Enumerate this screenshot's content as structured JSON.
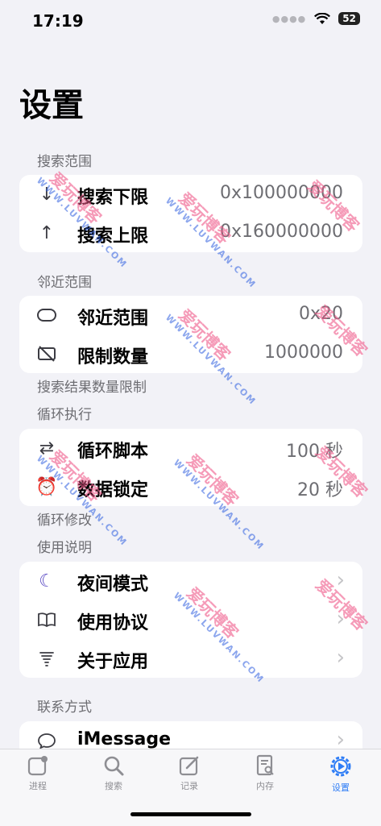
{
  "status_bar": {
    "time": "17:19",
    "battery": "52"
  },
  "title": "设置",
  "sections": {
    "search_range": {
      "header": "搜索范围",
      "rows": [
        {
          "label": "搜索下限",
          "value": "0x100000000",
          "icon": "arrow-down-icon"
        },
        {
          "label": "搜索上限",
          "value": "0x160000000",
          "icon": "arrow-up-icon"
        }
      ]
    },
    "nearby_range": {
      "header": "邻近范围",
      "footer": "搜索结果数量限制",
      "rows": [
        {
          "label": "邻近范围",
          "value": "0x20",
          "icon": "capsule-icon"
        },
        {
          "label": "限制数量",
          "value": "1000000",
          "icon": "rectangle-slash-icon"
        }
      ]
    },
    "loop": {
      "header": "循环执行",
      "footer": "循环修改",
      "rows": [
        {
          "label": "循环脚本",
          "value": "100 秒",
          "icon": "repeat-icon"
        },
        {
          "label": "数据锁定",
          "value": "20 秒",
          "icon": "alarm-icon"
        }
      ]
    },
    "instructions": {
      "header": "使用说明",
      "rows": [
        {
          "label": "夜间模式",
          "icon": "moon-icon"
        },
        {
          "label": "使用协议",
          "icon": "book-icon"
        },
        {
          "label": "关于应用",
          "icon": "tornado-icon"
        }
      ]
    },
    "contact": {
      "header": "联系方式",
      "rows": [
        {
          "label": "iMessage",
          "icon": "message-bubble-icon"
        }
      ]
    }
  },
  "tab_bar": {
    "tabs": [
      {
        "label": "进程",
        "icon": "process-icon",
        "active": false
      },
      {
        "label": "搜索",
        "icon": "search-icon",
        "active": false
      },
      {
        "label": "记录",
        "icon": "edit-icon",
        "active": false
      },
      {
        "label": "内存",
        "icon": "memory-doc-icon",
        "active": false
      },
      {
        "label": "设置",
        "icon": "gear-icon",
        "active": true
      }
    ]
  },
  "watermark": {
    "cn": "爱玩博客",
    "en": "WWW.LUVWAN.COM"
  },
  "colors": {
    "accent": "#2f7df6",
    "background": "#f2f2f7",
    "secondary_text": "#6d6d72"
  }
}
